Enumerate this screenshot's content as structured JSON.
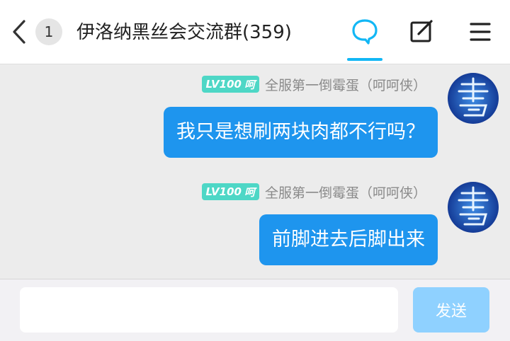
{
  "header": {
    "back_icon": "chevron-left-icon",
    "unread_count": "1",
    "title": "伊洛纳黑丝会交流群(359)",
    "icons": [
      "chat-bubble-icon",
      "edit-icon",
      "menu-icon"
    ],
    "accent_color": "#12b7f5"
  },
  "messages": [
    {
      "level": "LV100",
      "level_title": "呵",
      "sender": "全服第一倒霉蛋（呵呵侠）",
      "text": "我只是想刷两块肉都不行吗？"
    },
    {
      "level": "LV100",
      "level_title": "呵",
      "sender": "全服第一倒霉蛋（呵呵侠）",
      "text": "前脚进去后脚出来"
    }
  ],
  "input": {
    "value": "",
    "placeholder": "",
    "send_label": "发送"
  },
  "colors": {
    "bubble": "#1e95ee",
    "level_tag": "#4ed7c6",
    "send_button": "#8fd1ff",
    "chat_background": "#ececec"
  }
}
